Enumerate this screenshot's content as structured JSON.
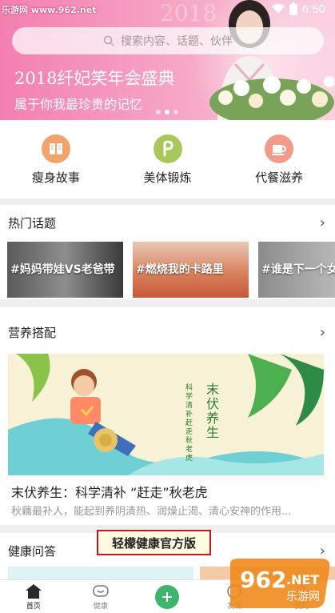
{
  "status_bar": {
    "watermark": "乐游网 www.962.net",
    "time": "6:50"
  },
  "hero": {
    "year_deco": "2018",
    "search_placeholder": "搜索内容、话题、伙伴",
    "title": "2018纤妃笑年会盛典",
    "subtitle": "属于你我最珍贵的记忆",
    "active_dot": 1
  },
  "categories": [
    {
      "label": "瘦身故事",
      "icon": "book-icon",
      "color": "#f2a26a"
    },
    {
      "label": "美体锻炼",
      "icon": "flex-icon",
      "color": "#a8c95a"
    },
    {
      "label": "代餐滋养",
      "icon": "cup-icon",
      "color": "#f39a8a"
    }
  ],
  "hot_topics": {
    "title": "热门话题",
    "items": [
      {
        "label": "#妈妈带娃VS老爸带"
      },
      {
        "label": "#燃烧我的卡路里"
      },
      {
        "label": "#谁是下一个女"
      }
    ]
  },
  "nutrition": {
    "title": "营养搭配",
    "article_title": "末伏养生：科学清补 “赶走”秋老虎",
    "article_desc": "秋藕最补人，能起到养阴清热、润燥止渴、清心安神的作用...",
    "image_vertical_title": "末伏养生",
    "image_vertical_sub": "科学清补 赶走秋老虎"
  },
  "health_qa": {
    "title": "健康问答"
  },
  "overlay_banner": "轻檬健康官方版",
  "bottom_nav": [
    {
      "label": "首页",
      "icon": "home-icon",
      "active": true
    },
    {
      "label": "健康",
      "icon": "chat-bubble-icon",
      "active": false
    },
    {
      "label": "",
      "icon": "plus-icon",
      "active": false
    },
    {
      "label": "发现",
      "icon": "discover-icon",
      "active": false
    },
    {
      "label": "我的",
      "icon": "profile-icon",
      "active": false
    }
  ],
  "corner_logo": "962.NET 乐游网"
}
